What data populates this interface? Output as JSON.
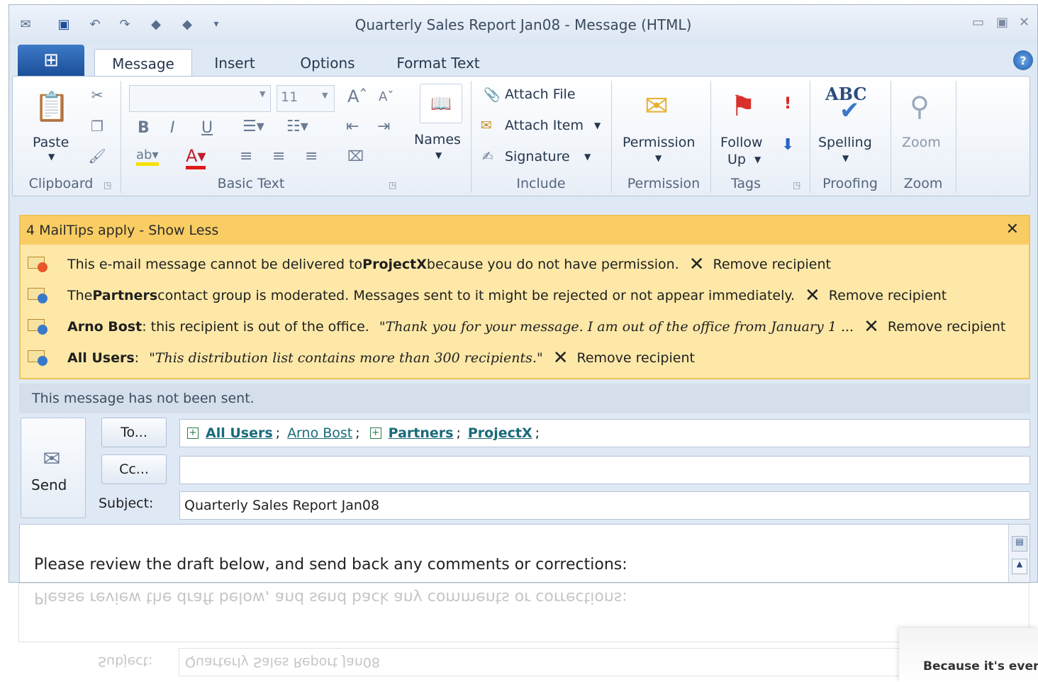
{
  "window": {
    "title": "Quarterly Sales Report Jan08  -  Message (HTML)"
  },
  "tabs": [
    {
      "label": "Message",
      "active": true
    },
    {
      "label": "Insert"
    },
    {
      "label": "Options"
    },
    {
      "label": "Format Text"
    }
  ],
  "ribbon": {
    "clipboard": {
      "paste_label": "Paste",
      "group_label": "Clipboard"
    },
    "basic_text": {
      "font_size": "11",
      "group_label": "Basic Text"
    },
    "names": {
      "label": "Names"
    },
    "include": {
      "attach_file": "Attach File",
      "attach_item": "Attach Item",
      "signature": "Signature",
      "group_label": "Include"
    },
    "permission": {
      "label": "Permission",
      "group_label": "Permission"
    },
    "tags": {
      "follow_up_1": "Follow",
      "follow_up_2": "Up",
      "group_label": "Tags"
    },
    "proofing": {
      "spelling": "Spelling",
      "spelling_icon_text": "ABC",
      "group_label": "Proofing"
    },
    "zoom": {
      "label": "Zoom",
      "group_label": "Zoom"
    }
  },
  "mailtips": {
    "header": "4 MailTips apply  -  Show Less",
    "rows": [
      {
        "pre": "This e-mail message cannot be delivered to ",
        "name": "ProjectX",
        "post": "because you do not have permission.",
        "action": "Remove recipient",
        "icon_color": "#e8552b"
      },
      {
        "pre": "The ",
        "name": "Partners",
        "post": "contact group is moderated. Messages sent to it might be rejected or not appear immediately.",
        "action": "Remove recipient",
        "icon_color": "#3a78c9"
      },
      {
        "name": "Arno Bost",
        "post": ": this recipient is out of the office.",
        "quote": "\"Thank you for your message. I am out of the office from January 1 ...",
        "action": "Remove recipient",
        "icon_color": "#3a78c9"
      },
      {
        "name": "All Users",
        "post": ":",
        "quote": "\"This distribution list contains more than 300 recipients.\"",
        "action": "Remove recipient",
        "icon_color": "#3a78c9"
      }
    ]
  },
  "status": {
    "not_sent": "This message has not been sent."
  },
  "compose": {
    "send_label": "Send",
    "to_button": "To...",
    "cc_button": "Cc...",
    "subject_label": "Subject:",
    "to_recipients": [
      {
        "text": "All Users",
        "expandable": true,
        "bold": true
      },
      {
        "text": "Arno Bost",
        "expandable": false,
        "bold": false
      },
      {
        "text": "Partners",
        "expandable": true,
        "bold": true
      },
      {
        "text": "ProjectX",
        "expandable": false,
        "bold": true
      }
    ],
    "cc_value": "",
    "subject_value": "Quarterly Sales Report Jan08",
    "body_text": "Please review the draft below, and send back any comments or corrections:"
  },
  "caption": {
    "text": "Because it's every"
  },
  "colors": {
    "mailtip_bg": "#fde8a8",
    "mailtip_header": "#f9cd63",
    "ribbon_accent": "#1b4f98"
  }
}
